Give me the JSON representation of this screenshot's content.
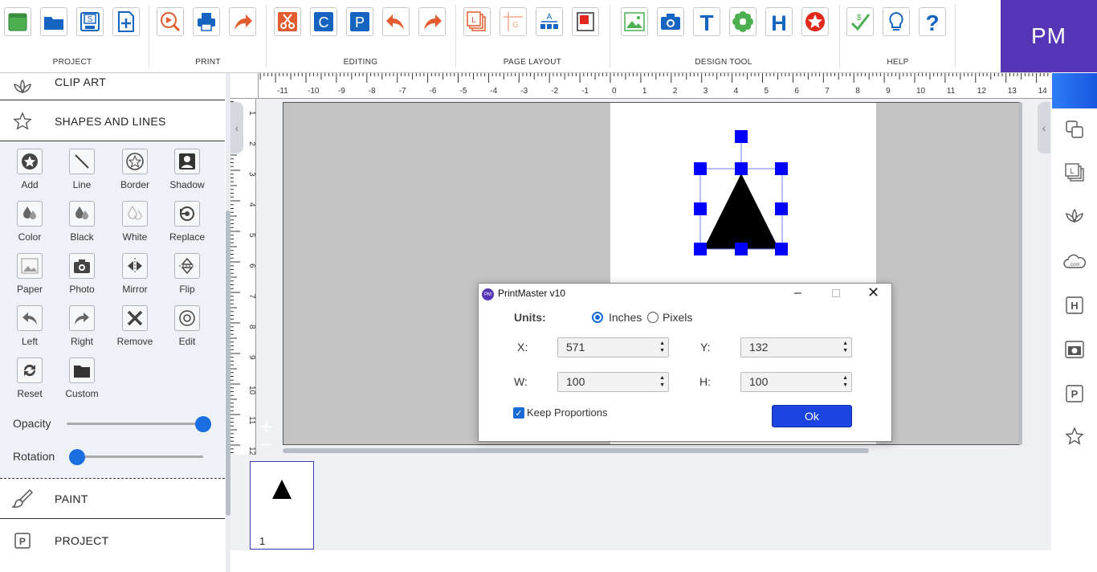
{
  "app": {
    "brand": "PM"
  },
  "toolbar": {
    "groups": [
      "PROJECT",
      "PRINT",
      "EDITING",
      "PAGE LAYOUT",
      "DESIGN TOOL",
      "HELP"
    ],
    "buttons": [
      {
        "icon": "new-project-icon"
      },
      {
        "icon": "open-folder-icon"
      },
      {
        "icon": "save-icon"
      },
      {
        "icon": "add-page-icon"
      },
      {
        "icon": "print-preview-icon"
      },
      {
        "icon": "printer-icon"
      },
      {
        "icon": "share-icon"
      },
      {
        "icon": "cut-icon"
      },
      {
        "icon": "copy-icon",
        "glyph": "C"
      },
      {
        "icon": "paste-icon",
        "glyph": "P"
      },
      {
        "icon": "undo-icon"
      },
      {
        "icon": "redo-icon"
      },
      {
        "icon": "layers-icon"
      },
      {
        "icon": "grid-icon"
      },
      {
        "icon": "align-icon"
      },
      {
        "icon": "layout-icon"
      },
      {
        "icon": "image-icon"
      },
      {
        "icon": "camera-icon"
      },
      {
        "icon": "text-icon",
        "glyph": "T"
      },
      {
        "icon": "clipart-icon"
      },
      {
        "icon": "headline-icon",
        "glyph": "H"
      },
      {
        "icon": "shape-star-icon"
      },
      {
        "icon": "check-spelling-icon"
      },
      {
        "icon": "tips-lightbulb-icon"
      },
      {
        "icon": "help-question-icon",
        "glyph": "?"
      }
    ]
  },
  "leftpanel": {
    "sections": {
      "clip_art": "CLIP ART",
      "shapes": "SHAPES AND LINES",
      "paint": "PAINT",
      "project": "PROJECT"
    },
    "tools": [
      "Add",
      "Line",
      "Border",
      "Shadow",
      "Color",
      "Black",
      "White",
      "Replace",
      "Paper",
      "Photo",
      "Mirror",
      "Flip",
      "Left",
      "Right",
      "Remove",
      "Edit",
      "Reset",
      "Custom"
    ],
    "opacity": {
      "label": "Opacity",
      "value": 1.0
    },
    "rotation": {
      "label": "Rotation",
      "value": 0.0
    }
  },
  "ruler": {
    "h_ticks": [
      "-11",
      "-10",
      "-9",
      "-8",
      "-7",
      "-6",
      "-5",
      "-4",
      "-3",
      "-2",
      "-1",
      "0",
      "1",
      "2",
      "3",
      "4",
      "5",
      "6",
      "7",
      "8",
      "9",
      "10",
      "11",
      "12",
      "13",
      "14"
    ],
    "v_ticks": [
      "0",
      "1",
      "2",
      "3",
      "4",
      "5",
      "6",
      "7",
      "8",
      "9",
      "10",
      "11",
      "12"
    ]
  },
  "pages": {
    "current": "1"
  },
  "dialog": {
    "title": "PrintMaster v10",
    "units_label": "Units:",
    "unit_inches": "Inches",
    "unit_pixels": "Pixels",
    "selected_unit": "Inches",
    "x_label": "X:",
    "x_value": "571",
    "y_label": "Y:",
    "y_value": "132",
    "w_label": "W:",
    "w_value": "100",
    "h_label": "H:",
    "h_value": "100",
    "keep_proportions": "Keep Proportions",
    "keep_checked": true,
    "ok": "Ok"
  },
  "colors": {
    "accent": "#1b44e0",
    "brand": "#5535b5",
    "handle": "#0000ff"
  }
}
